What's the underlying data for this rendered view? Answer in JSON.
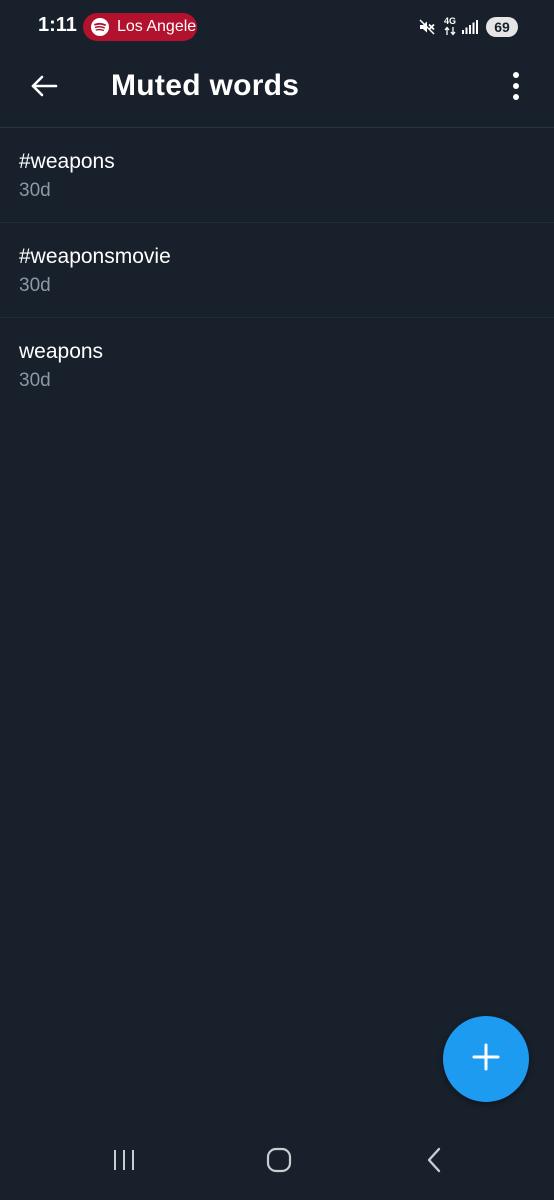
{
  "status_bar": {
    "time": "1:11",
    "spotify_pill_text": "Los Angeles",
    "network_type": "4G",
    "battery_level": "69",
    "icons": [
      "spotify-icon",
      "mute-icon",
      "data-arrows-icon",
      "signal-icon",
      "battery-icon"
    ]
  },
  "header": {
    "title": "Muted words",
    "back_icon": "arrow-left-icon",
    "menu_icon": "more-vertical-icon"
  },
  "muted_words": [
    {
      "word": "#weapons",
      "duration": "30d"
    },
    {
      "word": "#weaponsmovie",
      "duration": "30d"
    },
    {
      "word": "weapons",
      "duration": "30d"
    }
  ],
  "fab": {
    "icon": "plus-icon"
  },
  "nav_bar": {
    "icons": [
      "recent-apps-icon",
      "home-icon",
      "back-icon"
    ]
  },
  "colors": {
    "background": "#17202b",
    "accent": "#1d9bf0",
    "secondary_text": "#8b98a5",
    "spotify_pill": "#b3122e"
  }
}
